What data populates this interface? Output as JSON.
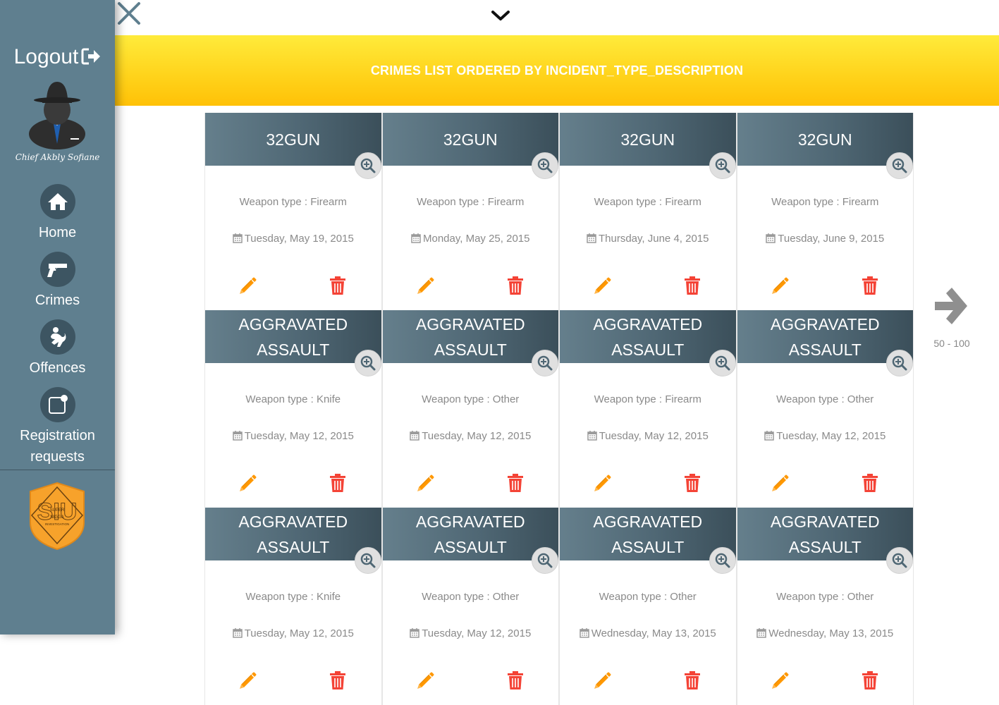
{
  "sidebar": {
    "logout_label": "Logout",
    "user_name": "Chief Akbly Sofiane",
    "items": [
      {
        "label": "Home",
        "icon": "home-icon"
      },
      {
        "label": "Crimes",
        "icon": "gun-icon"
      },
      {
        "label": "Offences",
        "icon": "offence-icon"
      },
      {
        "label": "Registration requests",
        "icon": "edit-square-icon"
      }
    ],
    "badge_text": [
      "SUPER",
      "NIGGA",
      "INVESTIGATION"
    ]
  },
  "header": {
    "title": "CRIMES LIST ORDERED BY INCIDENT_TYPE_DESCRIPTION"
  },
  "crimes": [
    {
      "type": "32GUN",
      "weapon": "Weapon type : Firearm",
      "date": "Tuesday, May 19, 2015"
    },
    {
      "type": "32GUN",
      "weapon": "Weapon type : Firearm",
      "date": "Monday, May 25, 2015"
    },
    {
      "type": "32GUN",
      "weapon": "Weapon type : Firearm",
      "date": "Thursday, June 4, 2015"
    },
    {
      "type": "32GUN",
      "weapon": "Weapon type : Firearm",
      "date": "Tuesday, June 9, 2015"
    },
    {
      "type": "AGGRAVATED ASSAULT",
      "weapon": "Weapon type : Knife",
      "date": "Tuesday, May 12, 2015"
    },
    {
      "type": "AGGRAVATED ASSAULT",
      "weapon": "Weapon type : Other",
      "date": "Tuesday, May 12, 2015"
    },
    {
      "type": "AGGRAVATED ASSAULT",
      "weapon": "Weapon type : Firearm",
      "date": "Tuesday, May 12, 2015"
    },
    {
      "type": "AGGRAVATED ASSAULT",
      "weapon": "Weapon type : Other",
      "date": "Tuesday, May 12, 2015"
    },
    {
      "type": "AGGRAVATED ASSAULT",
      "weapon": "Weapon type : Knife",
      "date": "Tuesday, May 12, 2015"
    },
    {
      "type": "AGGRAVATED ASSAULT",
      "weapon": "Weapon type : Other",
      "date": "Tuesday, May 12, 2015"
    },
    {
      "type": "AGGRAVATED ASSAULT",
      "weapon": "Weapon type : Other",
      "date": "Wednesday, May 13, 2015"
    },
    {
      "type": "AGGRAVATED ASSAULT",
      "weapon": "Weapon type : Other",
      "date": "Wednesday, May 13, 2015"
    }
  ],
  "pager": {
    "range": "50 - 100",
    "next_icon": "arrow-right-icon"
  },
  "colors": {
    "sidebar": "#5f7f8f",
    "banner": "#ffd21a",
    "card_header": "#4f6774",
    "edit": "#ff9800",
    "delete": "#f44336"
  }
}
